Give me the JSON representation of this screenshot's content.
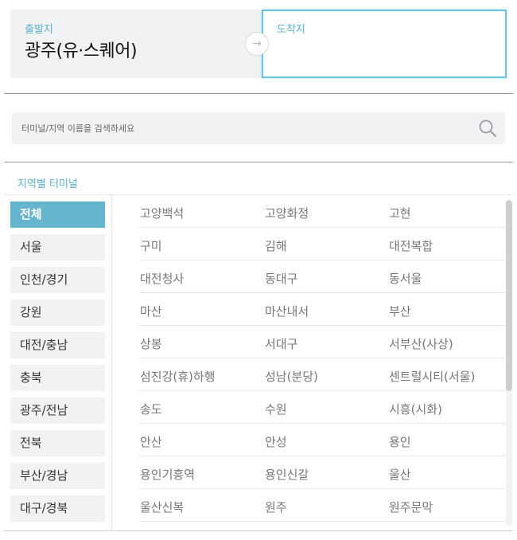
{
  "route": {
    "departure_label": "출발지",
    "departure_value": "광주(유·스퀘어)",
    "swap_icon": "→",
    "arrival_label": "도착지"
  },
  "search": {
    "placeholder": "터미널/지역 이름을 검색하세요",
    "icon": "search-icon"
  },
  "section_title": "지역별 터미널",
  "regions": [
    {
      "label": "전체",
      "active": true
    },
    {
      "label": "서울",
      "active": false
    },
    {
      "label": "인천/경기",
      "active": false
    },
    {
      "label": "강원",
      "active": false
    },
    {
      "label": "대전/충남",
      "active": false
    },
    {
      "label": "충북",
      "active": false
    },
    {
      "label": "광주/전남",
      "active": false
    },
    {
      "label": "전북",
      "active": false
    },
    {
      "label": "부산/경남",
      "active": false
    },
    {
      "label": "대구/경북",
      "active": false
    }
  ],
  "terminals": [
    [
      "고양백석",
      "고양화정",
      "고현"
    ],
    [
      "구미",
      "김해",
      "대전복합"
    ],
    [
      "대전청사",
      "동대구",
      "동서울"
    ],
    [
      "마산",
      "마산내서",
      "부산"
    ],
    [
      "상봉",
      "서대구",
      "서부산(사상)"
    ],
    [
      "섬진강(휴)하행",
      "성남(분당)",
      "센트럴시티(서울)"
    ],
    [
      "송도",
      "수원",
      "시흥(시화)"
    ],
    [
      "안산",
      "안성",
      "용인"
    ],
    [
      "용인기흥역",
      "용인신갈",
      "울산"
    ],
    [
      "울산신복",
      "원주",
      "원주문막"
    ]
  ],
  "colors": {
    "accent": "#66b5cf",
    "label": "#5ab0cc",
    "arrival_border": "#6cc3dd"
  }
}
